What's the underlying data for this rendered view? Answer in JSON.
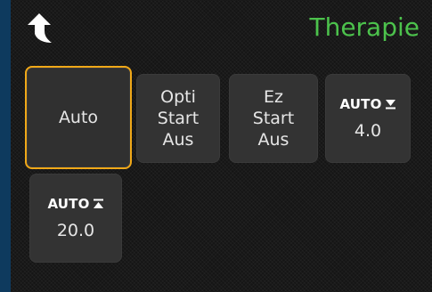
{
  "header": {
    "title": "Therapie",
    "back_icon": "back-arrow-icon"
  },
  "colors": {
    "title": "#4cc24c",
    "selection": "#f0a818",
    "tile": "#333333"
  },
  "tiles": {
    "mode": {
      "label": "Auto",
      "selected": true
    },
    "opti_start": {
      "line1": "Opti",
      "line2": "Start",
      "line3": "Aus"
    },
    "ez_start": {
      "line1": "Ez",
      "line2": "Start",
      "line3": "Aus"
    },
    "auto_min": {
      "label": "AUTO",
      "icon": "arrow-down-to-bar-icon",
      "value": "4.0"
    },
    "auto_max": {
      "label": "AUTO",
      "icon": "arrow-up-to-bar-icon",
      "value": "20.0"
    }
  }
}
